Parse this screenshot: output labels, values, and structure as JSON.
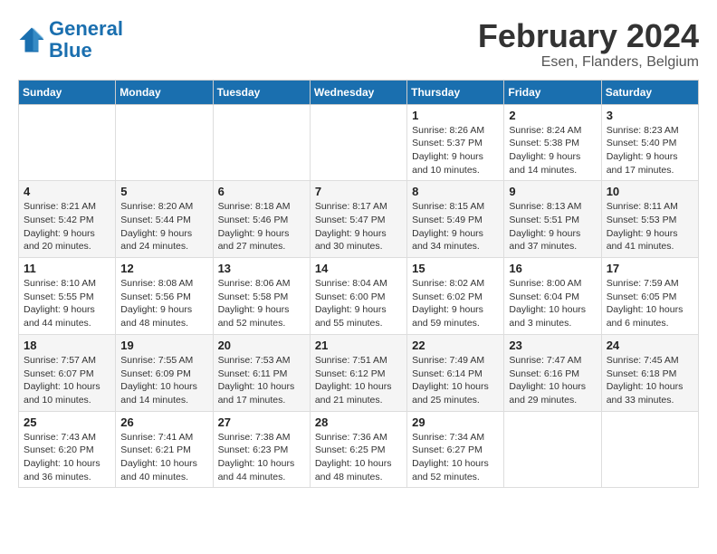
{
  "header": {
    "logo_line1": "General",
    "logo_line2": "Blue",
    "title": "February 2024",
    "subtitle": "Esen, Flanders, Belgium"
  },
  "weekdays": [
    "Sunday",
    "Monday",
    "Tuesday",
    "Wednesday",
    "Thursday",
    "Friday",
    "Saturday"
  ],
  "weeks": [
    [
      {
        "day": "",
        "info": ""
      },
      {
        "day": "",
        "info": ""
      },
      {
        "day": "",
        "info": ""
      },
      {
        "day": "",
        "info": ""
      },
      {
        "day": "1",
        "info": "Sunrise: 8:26 AM\nSunset: 5:37 PM\nDaylight: 9 hours\nand 10 minutes."
      },
      {
        "day": "2",
        "info": "Sunrise: 8:24 AM\nSunset: 5:38 PM\nDaylight: 9 hours\nand 14 minutes."
      },
      {
        "day": "3",
        "info": "Sunrise: 8:23 AM\nSunset: 5:40 PM\nDaylight: 9 hours\nand 17 minutes."
      }
    ],
    [
      {
        "day": "4",
        "info": "Sunrise: 8:21 AM\nSunset: 5:42 PM\nDaylight: 9 hours\nand 20 minutes."
      },
      {
        "day": "5",
        "info": "Sunrise: 8:20 AM\nSunset: 5:44 PM\nDaylight: 9 hours\nand 24 minutes."
      },
      {
        "day": "6",
        "info": "Sunrise: 8:18 AM\nSunset: 5:46 PM\nDaylight: 9 hours\nand 27 minutes."
      },
      {
        "day": "7",
        "info": "Sunrise: 8:17 AM\nSunset: 5:47 PM\nDaylight: 9 hours\nand 30 minutes."
      },
      {
        "day": "8",
        "info": "Sunrise: 8:15 AM\nSunset: 5:49 PM\nDaylight: 9 hours\nand 34 minutes."
      },
      {
        "day": "9",
        "info": "Sunrise: 8:13 AM\nSunset: 5:51 PM\nDaylight: 9 hours\nand 37 minutes."
      },
      {
        "day": "10",
        "info": "Sunrise: 8:11 AM\nSunset: 5:53 PM\nDaylight: 9 hours\nand 41 minutes."
      }
    ],
    [
      {
        "day": "11",
        "info": "Sunrise: 8:10 AM\nSunset: 5:55 PM\nDaylight: 9 hours\nand 44 minutes."
      },
      {
        "day": "12",
        "info": "Sunrise: 8:08 AM\nSunset: 5:56 PM\nDaylight: 9 hours\nand 48 minutes."
      },
      {
        "day": "13",
        "info": "Sunrise: 8:06 AM\nSunset: 5:58 PM\nDaylight: 9 hours\nand 52 minutes."
      },
      {
        "day": "14",
        "info": "Sunrise: 8:04 AM\nSunset: 6:00 PM\nDaylight: 9 hours\nand 55 minutes."
      },
      {
        "day": "15",
        "info": "Sunrise: 8:02 AM\nSunset: 6:02 PM\nDaylight: 9 hours\nand 59 minutes."
      },
      {
        "day": "16",
        "info": "Sunrise: 8:00 AM\nSunset: 6:04 PM\nDaylight: 10 hours\nand 3 minutes."
      },
      {
        "day": "17",
        "info": "Sunrise: 7:59 AM\nSunset: 6:05 PM\nDaylight: 10 hours\nand 6 minutes."
      }
    ],
    [
      {
        "day": "18",
        "info": "Sunrise: 7:57 AM\nSunset: 6:07 PM\nDaylight: 10 hours\nand 10 minutes."
      },
      {
        "day": "19",
        "info": "Sunrise: 7:55 AM\nSunset: 6:09 PM\nDaylight: 10 hours\nand 14 minutes."
      },
      {
        "day": "20",
        "info": "Sunrise: 7:53 AM\nSunset: 6:11 PM\nDaylight: 10 hours\nand 17 minutes."
      },
      {
        "day": "21",
        "info": "Sunrise: 7:51 AM\nSunset: 6:12 PM\nDaylight: 10 hours\nand 21 minutes."
      },
      {
        "day": "22",
        "info": "Sunrise: 7:49 AM\nSunset: 6:14 PM\nDaylight: 10 hours\nand 25 minutes."
      },
      {
        "day": "23",
        "info": "Sunrise: 7:47 AM\nSunset: 6:16 PM\nDaylight: 10 hours\nand 29 minutes."
      },
      {
        "day": "24",
        "info": "Sunrise: 7:45 AM\nSunset: 6:18 PM\nDaylight: 10 hours\nand 33 minutes."
      }
    ],
    [
      {
        "day": "25",
        "info": "Sunrise: 7:43 AM\nSunset: 6:20 PM\nDaylight: 10 hours\nand 36 minutes."
      },
      {
        "day": "26",
        "info": "Sunrise: 7:41 AM\nSunset: 6:21 PM\nDaylight: 10 hours\nand 40 minutes."
      },
      {
        "day": "27",
        "info": "Sunrise: 7:38 AM\nSunset: 6:23 PM\nDaylight: 10 hours\nand 44 minutes."
      },
      {
        "day": "28",
        "info": "Sunrise: 7:36 AM\nSunset: 6:25 PM\nDaylight: 10 hours\nand 48 minutes."
      },
      {
        "day": "29",
        "info": "Sunrise: 7:34 AM\nSunset: 6:27 PM\nDaylight: 10 hours\nand 52 minutes."
      },
      {
        "day": "",
        "info": ""
      },
      {
        "day": "",
        "info": ""
      }
    ]
  ]
}
